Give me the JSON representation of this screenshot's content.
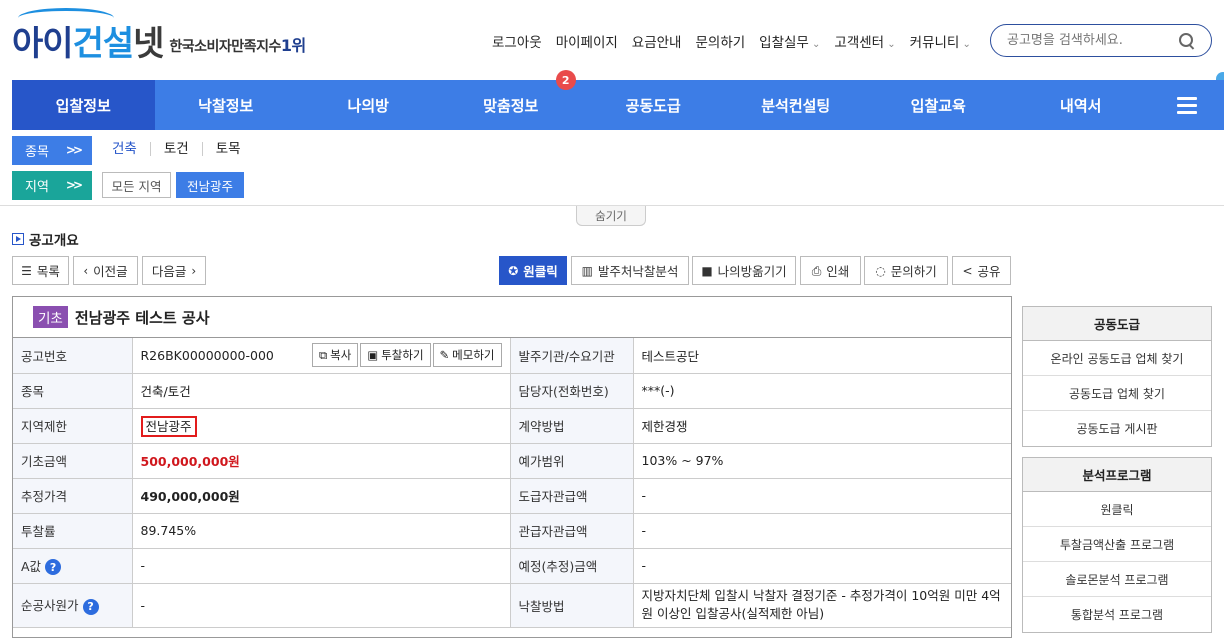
{
  "logo": {
    "part1": "아이",
    "part2": "건설",
    "part3": "넷",
    "tagline": "한국소비자만족지수",
    "rank": "1위"
  },
  "topnav": [
    "로그아웃",
    "마이페이지",
    "요금안내",
    "문의하기",
    "입찰실무",
    "고객센터",
    "커뮤니티"
  ],
  "search": {
    "placeholder": "공고명을 검색하세요."
  },
  "mainnav": {
    "items": [
      "입찰정보",
      "낙찰정보",
      "나의방",
      "맞춤정보",
      "공동도급",
      "분석컨설팅",
      "입찰교육",
      "내역서"
    ],
    "badge": "2"
  },
  "filters": {
    "kind_label": "종목",
    "kinds": [
      "건축",
      "토건",
      "토목"
    ],
    "region_label": "지역",
    "region_all": "모든 지역",
    "region_selected": "전남광주"
  },
  "hide_label": "숨기기",
  "section_title": "공고개요",
  "toolbar": {
    "list": "목록",
    "prev": "이전글",
    "next": "다음글",
    "oneclick": "원클릭",
    "analysis": "발주처낙찰분석",
    "save": "나의방옮기기",
    "print": "인쇄",
    "inquiry": "문의하기",
    "share": "공유"
  },
  "notice": {
    "tag": "기초",
    "title": "전남광주 테스트 공사",
    "copy_btn": "복사",
    "bid_btn": "투찰하기",
    "memo_btn": "메모하기",
    "rows": [
      {
        "l1": "공고번호",
        "v1": "R26BK00000000-000",
        "l2": "발주기관/수요기관",
        "v2": "테스트공단"
      },
      {
        "l1": "종목",
        "v1": "건축/토건",
        "l2": "담당자(전화번호)",
        "v2": "***(-)"
      },
      {
        "l1": "지역제한",
        "v1": "전남광주",
        "l2": "계약방법",
        "v2": "제한경쟁"
      },
      {
        "l1": "기초금액",
        "v1": "500,000,000원",
        "l2": "예가범위",
        "v2": "103% ~ 97%"
      },
      {
        "l1": "추정가격",
        "v1": "490,000,000원",
        "l2": "도급자관급액",
        "v2": "-"
      },
      {
        "l1": "투찰률",
        "v1": "89.745%",
        "l2": "관급자관급액",
        "v2": "-"
      },
      {
        "l1": "A값",
        "v1": "-",
        "l2": "예정(추정)금액",
        "v2": "-"
      },
      {
        "l1": "순공사원가",
        "v1": "-",
        "l2": "낙찰방법",
        "v2": "지방자치단체 입찰시 낙찰자 결정기준 - 추정가격이 10억원 미만 4억원 이상인 입찰공사(실적제한 아님)"
      }
    ]
  },
  "side1": {
    "title": "공동도급",
    "items": [
      "온라인 공동도급 업체 찾기",
      "공동도급 업체 찾기",
      "공동도급 게시판"
    ]
  },
  "side2": {
    "title": "분석프로그램",
    "items": [
      "원클릭",
      "투찰금액산출 프로그램",
      "솔로몬분석 프로그램",
      "통합분석 프로그램"
    ]
  },
  "colors": {
    "nav": "#3d7de6",
    "nav_active": "#2756c9",
    "region": "#1aa59a",
    "tag": "#8a4fb0",
    "price": "#d0171d"
  }
}
